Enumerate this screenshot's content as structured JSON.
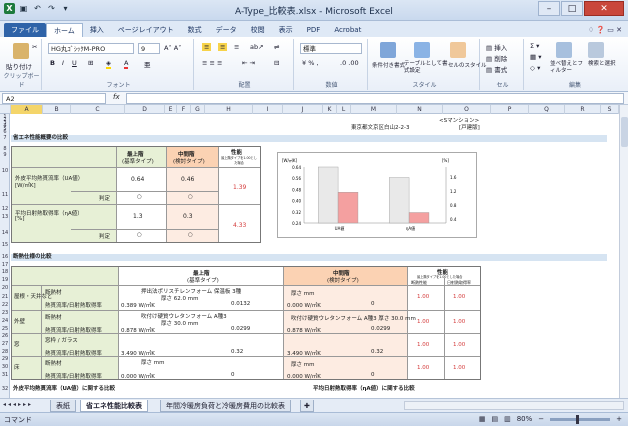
{
  "window": {
    "title": "A-Type_比較表.xlsx - Microsoft Excel",
    "controls": [
      "–",
      "□",
      "✕"
    ]
  },
  "tabs": [
    "ファイル",
    "ホーム",
    "挿入",
    "ページレイアウト",
    "数式",
    "データ",
    "校閲",
    "表示",
    "PDF",
    "Acrobat"
  ],
  "ribbon": {
    "clipboard": {
      "label": "クリップボード",
      "paste": "貼り付け"
    },
    "font": {
      "label": "フォント",
      "name": "HG丸ｺﾞｼｯｸM-PRO",
      "size": "9"
    },
    "alignment": {
      "label": "配置"
    },
    "number": {
      "label": "数値",
      "format": "標準"
    },
    "styles": {
      "label": "スタイル",
      "cond": "条件付き書式",
      "table": "テーブルとして書式設定",
      "cell": "セルのスタイル"
    },
    "cells": {
      "label": "セル",
      "insert": "挿入",
      "delete": "削除",
      "format": "書式"
    },
    "editing": {
      "label": "編集",
      "sort": "並べ替えとフィルター",
      "find": "検索と選択"
    }
  },
  "formula_bar": {
    "name_box": "A2",
    "fx": "fx",
    "value": ""
  },
  "columns": [
    "A",
    "B",
    "C",
    "D",
    "E",
    "F",
    "G",
    "H",
    "I",
    "J",
    "K",
    "L",
    "M",
    "N",
    "O",
    "P",
    "Q",
    "R",
    "S"
  ],
  "rows": [
    "1",
    "2",
    "3",
    "4",
    "5",
    "6",
    "7",
    "8",
    "9",
    "10",
    "11",
    "12",
    "13",
    "14",
    "15",
    "16",
    "17",
    "18",
    "19",
    "20",
    "21",
    "22",
    "23",
    "24",
    "25",
    "26",
    "27",
    "28",
    "29",
    "30",
    "31",
    "32"
  ],
  "sheet": {
    "header_right": [
      "<Sマンション>",
      "東京都文京区白山2-2-3",
      "[戸建版]"
    ],
    "section1": "省エネ性能概要の比較",
    "col_top": {
      "label": "最上階",
      "sub": "(基準タイプ)"
    },
    "col_mid": {
      "label": "中間階",
      "sub": "(検討タイプ)"
    },
    "col_perf": {
      "label": "性能",
      "sub": "最上階タイプを1.00とした場合"
    },
    "row_ua": {
      "label": "外皮平均熱貫流率（UA値）",
      "unit": "[W/㎡K]",
      "judge": "判定",
      "top": "0.64",
      "mid": "0.46",
      "perf": "1.39",
      "j1": "○",
      "j2": "○"
    },
    "row_eta": {
      "label": "平均日射熱取得率（ηA値）",
      "unit": "[%]",
      "judge": "判定",
      "top": "1.3",
      "mid": "0.3",
      "perf": "4.33",
      "j1": "○",
      "j2": "○"
    },
    "mini_chart": {
      "left_unit": "[W/㎡K]",
      "right_unit": "[%]",
      "y_left": [
        "0.64",
        "0.56",
        "0.48",
        "0.40",
        "0.32",
        "0.24"
      ],
      "y_right": [
        "1.6",
        "1.2",
        "0.8",
        "0.4"
      ],
      "cat1": "UA値",
      "cat2": "ηA値"
    },
    "section2": "断熱仕様の比較",
    "spec_top": {
      "label": "最上階",
      "sub": "(基準タイプ)"
    },
    "spec_mid": {
      "label": "中間階",
      "sub": "(検討タイプ)"
    },
    "spec_perf": {
      "label": "性能",
      "sub": "最上階タイプを1.00とした場合"
    },
    "perf_cols": [
      "断熱性能",
      "日射熱取得率"
    ],
    "parts": [
      {
        "name": "屋根・天井など",
        "insul": "断熱材",
        "spec_top": "押出法ポリスチレンフォーム 保温板 3種",
        "thick_top": "厚さ 62.0 mm",
        "spec_mid": "厚さ mm",
        "uval": "熱貫流率/日射熱取得率",
        "v_top": "0.389 W/㎡K",
        "v_top2": "0.0132",
        "v_mid": "0.000 W/㎡K",
        "v_mid2": "0",
        "p1": "1.00",
        "p2": "1.00"
      },
      {
        "name": "外壁",
        "insul": "断熱材",
        "spec_top": "吹付け硬質ウレタンフォーム A種3",
        "thick_top": "厚さ 30.0 mm",
        "spec_mid": "吹付け硬質ウレタンフォーム A種3 厚さ 30.0 mm",
        "uval": "熱貫流率/日射熱取得率",
        "v_top": "0.878 W/㎡K",
        "v_top2": "0.0299",
        "v_mid": "0.878 W/㎡K",
        "v_mid2": "0.0299",
        "p1": "1.00",
        "p2": "1.00"
      },
      {
        "name": "窓",
        "insul": "窓枠 / ガラス",
        "spec_top": "",
        "thick_top": "",
        "spec_mid": "",
        "uval": "熱貫流率/日射熱取得率",
        "v_top": "3.490 W/㎡K",
        "v_top2": "0.32",
        "v_mid": "3.490 W/㎡K",
        "v_mid2": "0.32",
        "p1": "1.00",
        "p2": "1.00"
      },
      {
        "name": "床",
        "insul": "断熱材",
        "spec_top": "厚さ mm",
        "thick_top": "",
        "spec_mid": "厚さ mm",
        "uval": "熱貫流率/日射熱取得率",
        "v_top": "0.000 W/㎡K",
        "v_top2": "0",
        "v_mid": "0.000 W/㎡K",
        "v_mid2": "0",
        "p1": "1.00",
        "p2": "1.00"
      }
    ],
    "section3a": "外皮平均熱貫流率（UA値）に関する比較",
    "section3b": "平均日射熱取得率（ηA値）に関する比較"
  },
  "sheet_tabs": [
    "表紙",
    "省エネ性能比較表",
    "年間冷暖房負荷と冷暖房費用の比較表"
  ],
  "status": {
    "mode": "コマンド",
    "zoom": "80%"
  },
  "chart_data": {
    "type": "bar",
    "categories": [
      "UA値",
      "ηA値"
    ],
    "series": [
      {
        "values": [
          0.64,
          1.3
        ],
        "color": "#e9e9e9"
      },
      {
        "values": [
          0.46,
          0.3
        ],
        "color": "#f4a0a0"
      }
    ],
    "ylim_left": [
      0.24,
      0.64
    ],
    "ylim_right": [
      0,
      1.6
    ]
  }
}
